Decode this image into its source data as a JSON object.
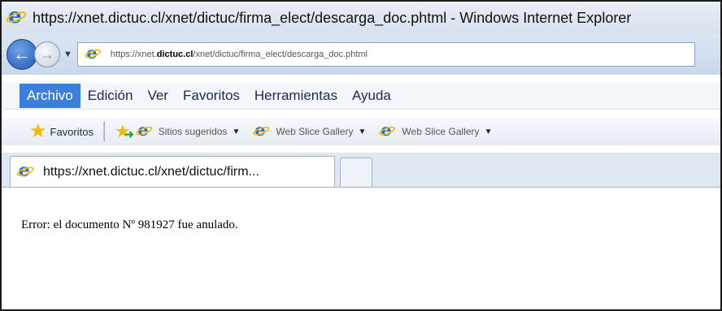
{
  "window": {
    "title": "https://xnet.dictuc.cl/xnet/dictuc/firma_elect/descarga_doc.phtml - Windows Internet Explorer"
  },
  "address_bar": {
    "url_prefix": "https://xnet.",
    "url_domain": "dictuc.cl",
    "url_path": "/xnet/dictuc/firma_elect/descarga_doc.phtml"
  },
  "menu": {
    "items": [
      "Archivo",
      "Edición",
      "Ver",
      "Favoritos",
      "Herramientas",
      "Ayuda"
    ]
  },
  "favorites_bar": {
    "favorites_label": "Favoritos",
    "links": [
      "Sitios sugeridos",
      "Web Slice Gallery",
      "Web Slice Gallery"
    ]
  },
  "tabs": [
    {
      "title": "https://xnet.dictuc.cl/xnet/dictuc/firm..."
    }
  ],
  "page": {
    "message": "Error: el documento Nº 981927 fue anulado."
  },
  "icons": {
    "browser": "ie-logo-icon",
    "back": "back-arrow-icon",
    "forward": "forward-arrow-icon",
    "favorites": "star-icon",
    "add_favorite": "add-favorite-icon"
  }
}
